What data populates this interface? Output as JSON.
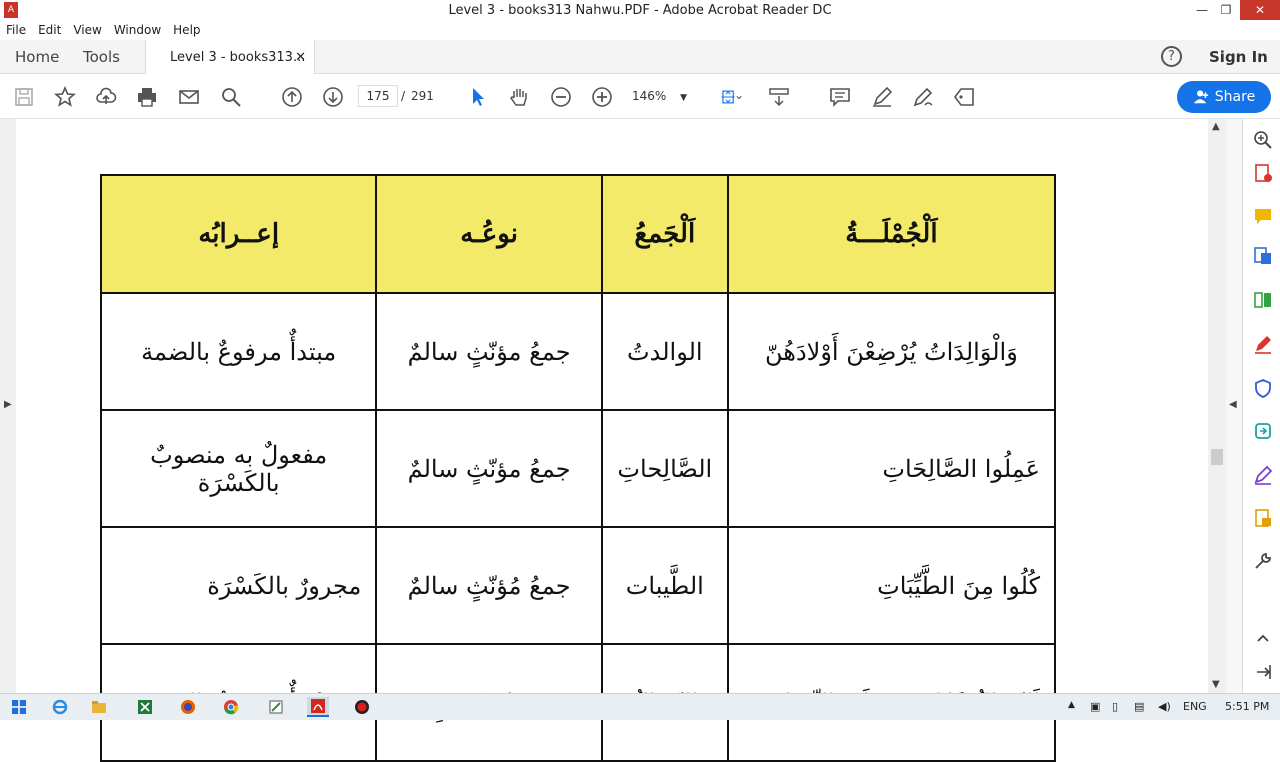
{
  "window": {
    "title": "Level 3 - books313 Nahwu.PDF - Adobe Acrobat Reader DC",
    "minimize": "—",
    "restore": "❐",
    "close": "✕"
  },
  "menu": [
    "File",
    "Edit",
    "View",
    "Window",
    "Help"
  ],
  "nav": {
    "home": "Home",
    "tools": "Tools",
    "doc_tab": "Level 3 - books313...",
    "close_tab": "✕",
    "help": "?",
    "sign_in": "Sign In"
  },
  "toolbar": {
    "current_page": "175",
    "separator": "/",
    "total_pages": "291",
    "zoom": "146%",
    "share": "Share"
  },
  "table": {
    "headers": [
      "اَلْجُمْلَـــةُ",
      "اَلْجَمعُ",
      "نوعُـه",
      "إعــرابُه"
    ],
    "rows": [
      [
        "وَالْوَالِدَاتُ يُرْضِعْنَ أَوْلادَهُنّ",
        "الوالدتُ",
        "جمعُ مؤنّثٍ سالمٌ",
        "مبتدأٌ مرفوعٌ بالضمة"
      ],
      [
        "عَمِلُوا الصَّالِحَاتِ",
        "الصَّالِحاتِ",
        "جمعُ مؤنّثٍ سالمٌ",
        "مفعولٌ به منصوبٌ بالكَسْرَة"
      ],
      [
        "كُلُوا مِنَ الطَّيِّبَاتِ",
        "الطَّيبات",
        "جمعُ مُؤنّثٍ سالمٌ",
        "مجرورٌ بالكَسْرَة"
      ],
      [
        "اَلرِّجَالُ قَوَّامُونَ عَلَى النِّسَاءِ",
        "الرِّجَالُ",
        "جمعُ تكسيرٍ",
        "مُبْتَدأٌ مرفوعٌ بالضمة"
      ]
    ]
  },
  "taskbar": {
    "lang": "ENG",
    "time": "5:51 PM"
  },
  "colors": {
    "header_fill": "#f3ea6a",
    "accent": "#1473e6",
    "acrobat_red": "#c8332b"
  }
}
